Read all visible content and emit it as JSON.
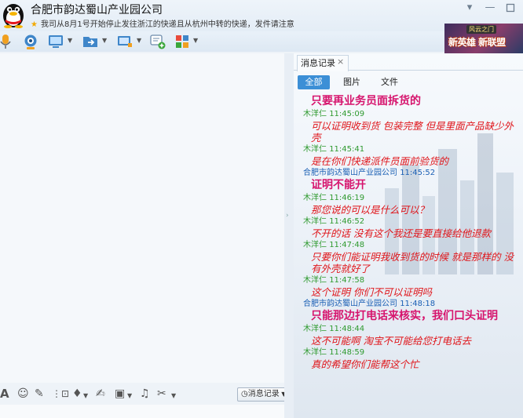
{
  "window": {
    "contact_name": "合肥市韵达蜀山产业园公司",
    "notice": "我司从8月1号开始停止发往浙江的快递且从杭州中转的快递，发件请注意",
    "minimize_glyph": "—",
    "menu_glyph": "▾"
  },
  "ad": {
    "small": "风云之门",
    "text": "新英雄 新联盟"
  },
  "history": {
    "tab_label": "消息记录",
    "filters": [
      "全部",
      "图片",
      "文件"
    ],
    "messages": [
      {
        "sender": "",
        "time": "",
        "text": "只要再业务员面拆货的",
        "style": "bold"
      },
      {
        "sender": "木洋仁",
        "time": "11:45:09",
        "text": "可以证明收到货  包装完整  但是里面产品缺少外壳",
        "style": "italic",
        "who": "self"
      },
      {
        "sender": "木洋仁",
        "time": "11:45:41",
        "text": "是在你们快递派件员面前验货的",
        "style": "italic",
        "who": "self"
      },
      {
        "sender": "合肥市韵达蜀山产业园公司",
        "time": "11:45:52",
        "text": "证明不能开",
        "style": "bold",
        "who": "other"
      },
      {
        "sender": "木洋仁",
        "time": "11:46:19",
        "text": "那您说的可以是什么可以？",
        "style": "italic",
        "who": "self"
      },
      {
        "sender": "木洋仁",
        "time": "11:46:52",
        "text": "不开的话 没有这个我还是要直接给他退款",
        "style": "italic",
        "who": "self"
      },
      {
        "sender": "木洋仁",
        "time": "11:47:48",
        "text": "只要你们能证明我收到货的时候 就是那样的 没有外壳就好了",
        "style": "italic",
        "who": "self"
      },
      {
        "sender": "木洋仁",
        "time": "11:47:58",
        "text": "这个证明 你们不可以证明吗",
        "style": "italic",
        "who": "self"
      },
      {
        "sender": "合肥市韵达蜀山产业园公司",
        "time": "11:48:18",
        "text": "只能那边打电话来核实，我们口头证明",
        "style": "bold",
        "who": "other"
      },
      {
        "sender": "木洋仁",
        "time": "11:48:44",
        "text": "这不可能啊 淘宝不可能给您打电话去",
        "style": "italic",
        "who": "self"
      },
      {
        "sender": "木洋仁",
        "time": "11:48:59",
        "text": "真的希望你们能帮这个忙",
        "style": "italic",
        "who": "self"
      }
    ]
  },
  "input_toolbar": {
    "history_button": "消息记录"
  },
  "colors": {
    "accent": "#3c8fd6",
    "self_meta": "#2f9a2f",
    "other_meta": "#1a5fb4",
    "message_red": "#e0151a",
    "message_pink": "#d6146d"
  }
}
